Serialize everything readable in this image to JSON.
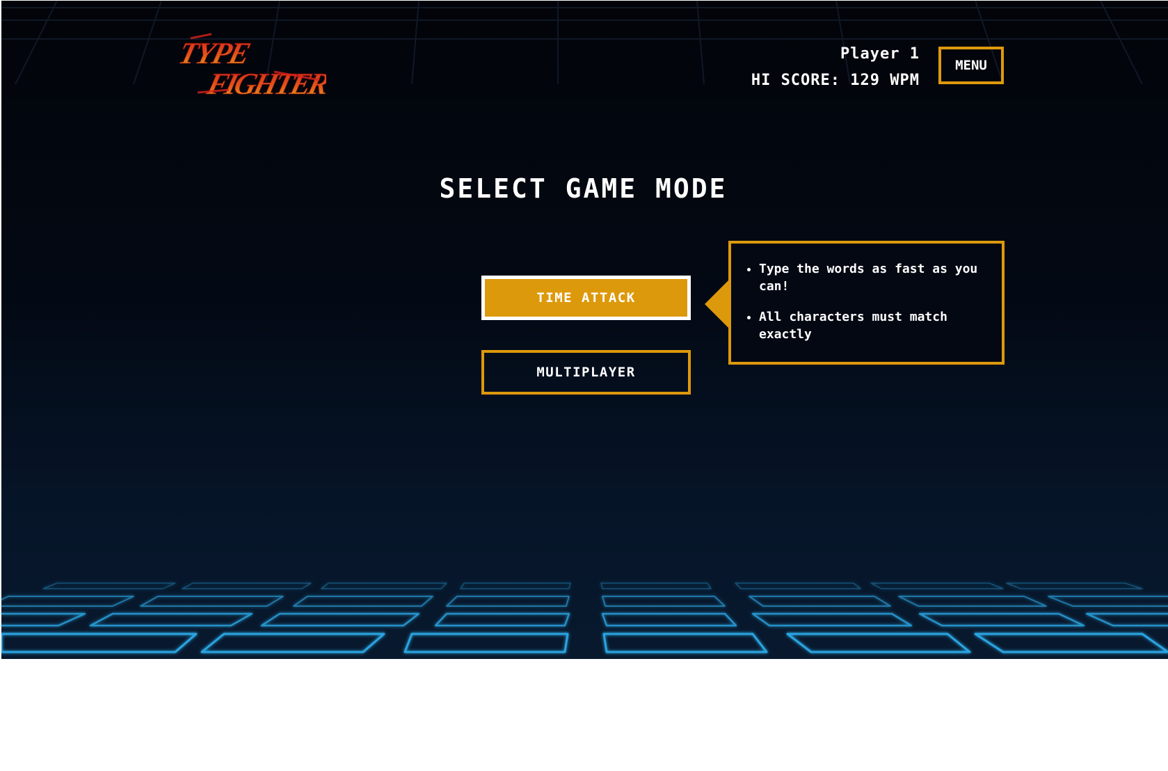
{
  "app": {
    "logo_line1": "TYPE",
    "logo_line2": "FIGHTER"
  },
  "header": {
    "player_label": "Player 1",
    "hi_score": "HI SCORE: 129 WPM",
    "menu_label": "MENU"
  },
  "main": {
    "title": "SELECT GAME MODE",
    "modes": [
      {
        "label": "TIME ATTACK",
        "selected": true
      },
      {
        "label": "MULTIPLAYER",
        "selected": false
      }
    ],
    "tooltip": {
      "bullets": [
        "Type the words as fast as you can!",
        "All characters must match exactly"
      ]
    }
  },
  "colors": {
    "accent": "#dd990c",
    "background": "#020409",
    "grid": "#2aa4e0",
    "logo_red": "#d8221c",
    "logo_gold": "#e8a520",
    "text": "#ffffff"
  }
}
